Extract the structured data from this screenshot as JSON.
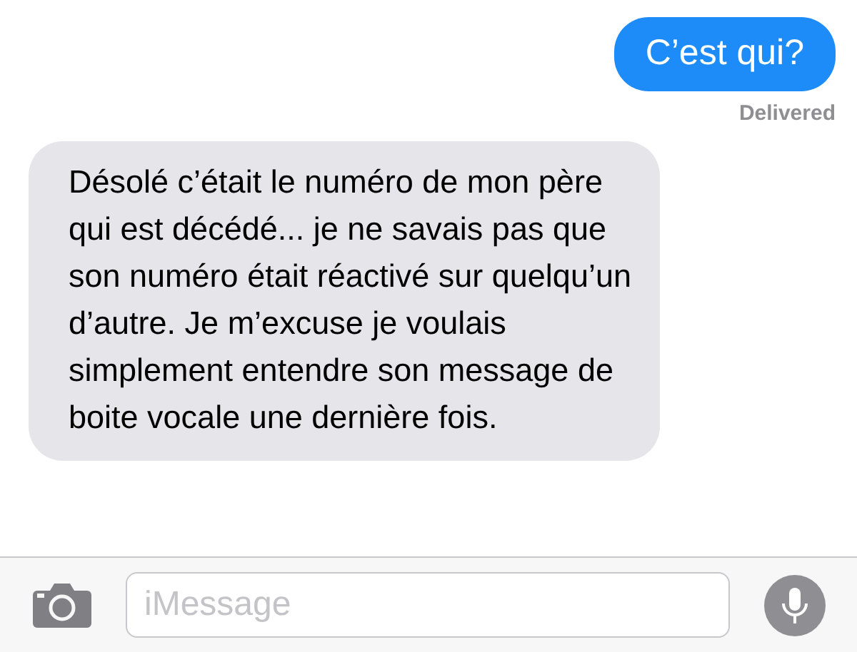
{
  "messages": [
    {
      "kind": "sent",
      "text": "C’est qui?",
      "status": "Delivered"
    },
    {
      "kind": "received",
      "text": "Désolé c’était le numéro de mon père qui est décédé... je ne savais pas que son numéro était réactivé sur quelqu’un d’autre. Je m’excuse je voulais simplement entendre son message de boite vocale une dernière fois."
    }
  ],
  "composer": {
    "placeholder": "iMessage"
  }
}
